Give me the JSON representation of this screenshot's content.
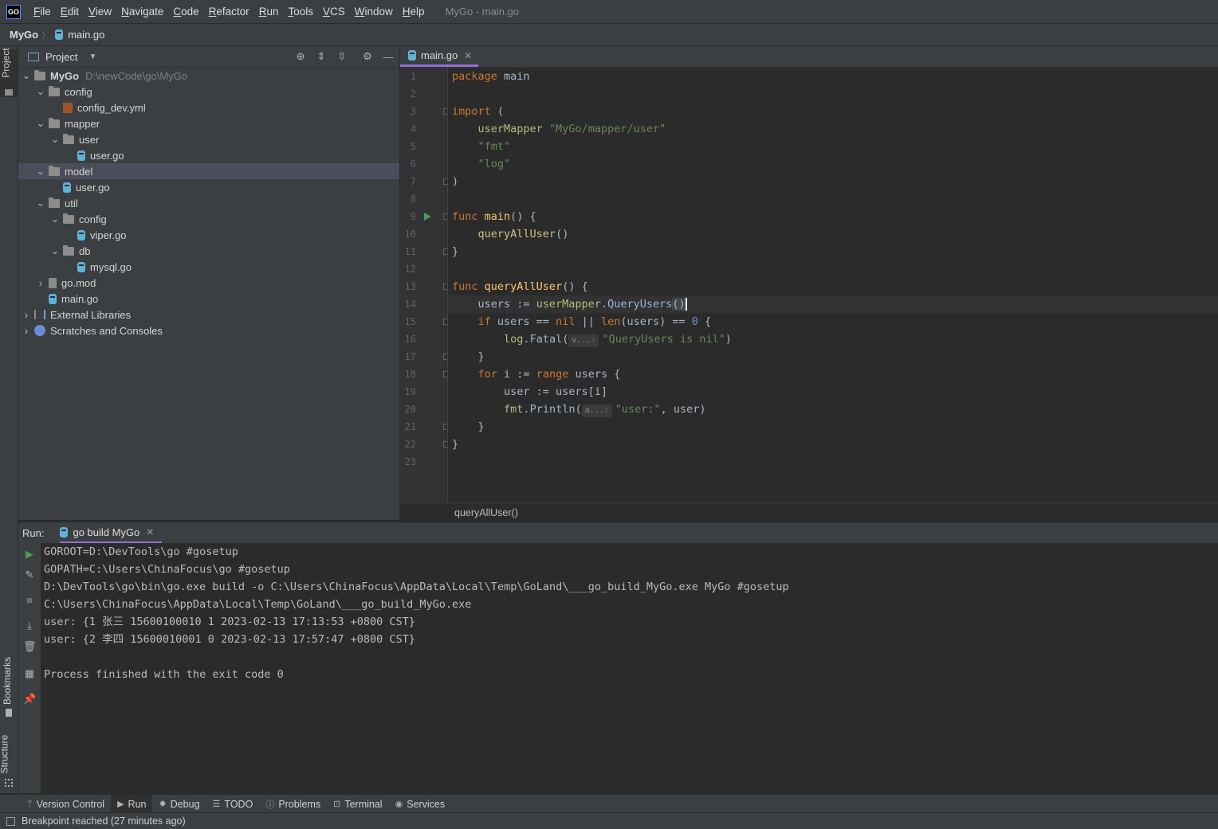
{
  "menu": {
    "logo": "GO",
    "items": [
      {
        "u": "F",
        "rest": "ile"
      },
      {
        "u": "E",
        "rest": "dit"
      },
      {
        "u": "V",
        "rest": "iew"
      },
      {
        "u": "N",
        "rest": "avigate"
      },
      {
        "u": "C",
        "rest": "ode"
      },
      {
        "u": "R",
        "rest": "efactor"
      },
      {
        "u": "R",
        "rest": "un"
      },
      {
        "u": "T",
        "rest": "ools"
      },
      {
        "u": "V",
        "rest": "CS"
      },
      {
        "u": "W",
        "rest": "indow"
      },
      {
        "u": "H",
        "rest": "elp"
      }
    ],
    "window_title": "MyGo - main.go"
  },
  "navbar": {
    "project": "MyGo",
    "separator": "〉",
    "file": "main.go"
  },
  "left_stripe": {
    "top_tab": "Project",
    "bookmarks": "Bookmarks",
    "structure": "Structure"
  },
  "project_panel": {
    "title": "Project",
    "tree": [
      {
        "label": "MyGo",
        "path": "D:\\newCode\\go\\MyGo",
        "kind": "folder",
        "depth": 0,
        "expanded": true,
        "bold": true
      },
      {
        "label": "config",
        "kind": "folder",
        "depth": 1,
        "expanded": true
      },
      {
        "label": "config_dev.yml",
        "kind": "yml",
        "depth": 2
      },
      {
        "label": "mapper",
        "kind": "folder",
        "depth": 1,
        "expanded": true
      },
      {
        "label": "user",
        "kind": "folder",
        "depth": 2,
        "expanded": true
      },
      {
        "label": "user.go",
        "kind": "go",
        "depth": 3
      },
      {
        "label": "model",
        "kind": "folder",
        "depth": 1,
        "expanded": true,
        "selected": true
      },
      {
        "label": "user.go",
        "kind": "go",
        "depth": 2
      },
      {
        "label": "util",
        "kind": "folder",
        "depth": 1,
        "expanded": true
      },
      {
        "label": "config",
        "kind": "folder",
        "depth": 2,
        "expanded": true
      },
      {
        "label": "viper.go",
        "kind": "go",
        "depth": 3
      },
      {
        "label": "db",
        "kind": "folder",
        "depth": 2,
        "expanded": true
      },
      {
        "label": "mysql.go",
        "kind": "go",
        "depth": 3
      },
      {
        "label": "go.mod",
        "kind": "mod",
        "depth": 1,
        "expanded": false
      },
      {
        "label": "main.go",
        "kind": "go",
        "depth": 1
      },
      {
        "label": "External Libraries",
        "kind": "lib",
        "depth": 0,
        "expanded": false
      },
      {
        "label": "Scratches and Consoles",
        "kind": "scratch",
        "depth": 0,
        "expanded": false
      }
    ]
  },
  "editor": {
    "tab_label": "main.go",
    "line_numbers": [
      "1",
      "2",
      "3",
      "4",
      "5",
      "6",
      "7",
      "8",
      "9",
      "10",
      "11",
      "12",
      "13",
      "14",
      "15",
      "16",
      "17",
      "18",
      "19",
      "20",
      "21",
      "22",
      "23"
    ],
    "breadcrumb": "queryAllUser()",
    "hints": {
      "v": "v...:",
      "a": "a...:"
    },
    "code": {
      "l1a": "package",
      "l1b": " main",
      "l3a": "import",
      "l3b": " (",
      "l4a": "    userMapper ",
      "l4b": "\"MyGo/mapper/user\"",
      "l5": "    \"fmt\"",
      "l6": "    \"log\"",
      "l7": ")",
      "l9a": "func",
      "l9b": " main",
      "l9c": "() {",
      "l10a": "    ",
      "l10b": "queryAllUser",
      "l10c": "()",
      "l11": "}",
      "l13a": "func",
      "l13b": " queryAllUser",
      "l13c": "() {",
      "l14a": "    users := ",
      "l14b": "userMapper",
      "l14c": ".",
      "l14d": "QueryUsers",
      "l14e": "()",
      "l15a": "    ",
      "l15b": "if",
      "l15c": " users == ",
      "l15d": "nil",
      "l15e": " || ",
      "l15f": "len",
      "l15g": "(users) == ",
      "l15h": "0",
      "l15i": " {",
      "l16a": "        ",
      "l16b": "log",
      "l16c": ".",
      "l16d": "Fatal",
      "l16e": "(",
      "l16f": "\"QueryUsers is nil\"",
      "l16g": ")",
      "l17": "    }",
      "l18a": "    ",
      "l18b": "for",
      "l18c": " i := ",
      "l18d": "range",
      "l18e": " users {",
      "l19": "        user := users[i]",
      "l20a": "        ",
      "l20b": "fmt",
      "l20c": ".",
      "l20d": "Println",
      "l20e": "(",
      "l20f": "\"user:\"",
      "l20g": ", user)",
      "l21": "    }",
      "l22": "}"
    }
  },
  "run_panel": {
    "label": "Run:",
    "tab_label": "go build MyGo",
    "output": [
      "GOROOT=D:\\DevTools\\go #gosetup",
      "GOPATH=C:\\Users\\ChinaFocus\\go #gosetup",
      "D:\\DevTools\\go\\bin\\go.exe build -o C:\\Users\\ChinaFocus\\AppData\\Local\\Temp\\GoLand\\___go_build_MyGo.exe MyGo #gosetup",
      "C:\\Users\\ChinaFocus\\AppData\\Local\\Temp\\GoLand\\___go_build_MyGo.exe",
      "user: {1 张三 15600100010 1 2023-02-13 17:13:53 +0800 CST}",
      "user: {2 李四 15600010001 0 2023-02-13 17:57:47 +0800 CST}",
      "",
      "Process finished with the exit code 0"
    ]
  },
  "toolwindows": [
    "Version Control",
    "Run",
    "Debug",
    "TODO",
    "Problems",
    "Terminal",
    "Services"
  ],
  "status": "Breakpoint reached (27 minutes ago)",
  "colors": {
    "accent": "#9270d5",
    "keyword": "#cc7832",
    "function": "#ffc66d",
    "string": "#6a8759",
    "number": "#6897bb",
    "run_green": "#499c54"
  }
}
